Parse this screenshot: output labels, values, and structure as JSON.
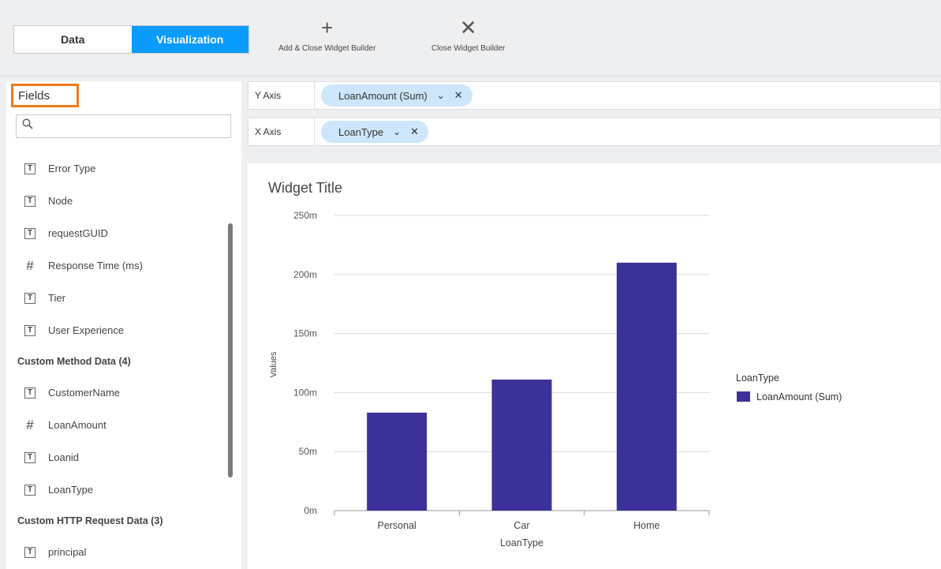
{
  "tabs": [
    {
      "label": "Data",
      "active": false
    },
    {
      "label": "Visualization",
      "active": true
    }
  ],
  "toolbar": {
    "add_close": {
      "icon": "plus-icon",
      "label": "Add & Close Widget Builder"
    },
    "close": {
      "icon": "close-icon",
      "label": "Close Widget Builder"
    }
  },
  "fields_panel": {
    "title": "Fields",
    "search": {
      "value": "",
      "placeholder": ""
    },
    "items": [
      {
        "type": "text",
        "label": "Error Type"
      },
      {
        "type": "text",
        "label": "Node"
      },
      {
        "type": "text",
        "label": "requestGUID"
      },
      {
        "type": "number",
        "label": "Response Time (ms)"
      },
      {
        "type": "text",
        "label": "Tier"
      },
      {
        "type": "text",
        "label": "User Experience"
      },
      {
        "type": "group",
        "label": "Custom Method Data (4)"
      },
      {
        "type": "text",
        "label": "CustomerName"
      },
      {
        "type": "number",
        "label": "LoanAmount"
      },
      {
        "type": "text",
        "label": "Loanid"
      },
      {
        "type": "text",
        "label": "LoanType"
      },
      {
        "type": "group",
        "label": "Custom HTTP Request Data (3)"
      },
      {
        "type": "text",
        "label": "principal"
      }
    ]
  },
  "y_axis": {
    "label": "Y Axis",
    "chip": "LoanAmount (Sum)"
  },
  "x_axis": {
    "label": "X Axis",
    "chip": "LoanType"
  },
  "widget_title": "Widget Title",
  "colors": {
    "accent": "#0a9bff",
    "bar": "#3b3199",
    "highlight": "#f07a1a",
    "chip": "#cde6fb"
  },
  "chart_data": {
    "type": "bar",
    "categories": [
      "Personal",
      "Car",
      "Home"
    ],
    "series": [
      {
        "name": "LoanAmount (Sum)",
        "values": [
          83,
          111,
          210
        ]
      }
    ],
    "ylim": [
      0,
      250
    ],
    "yticks": [
      0,
      50,
      100,
      150,
      200,
      250
    ],
    "ytick_labels": [
      "0m",
      "50m",
      "100m",
      "150m",
      "200m",
      "250m"
    ],
    "xlabel": "LoanType",
    "ylabel": "Values",
    "legend_title": "LoanType",
    "legend_position": "right",
    "grid": true
  }
}
